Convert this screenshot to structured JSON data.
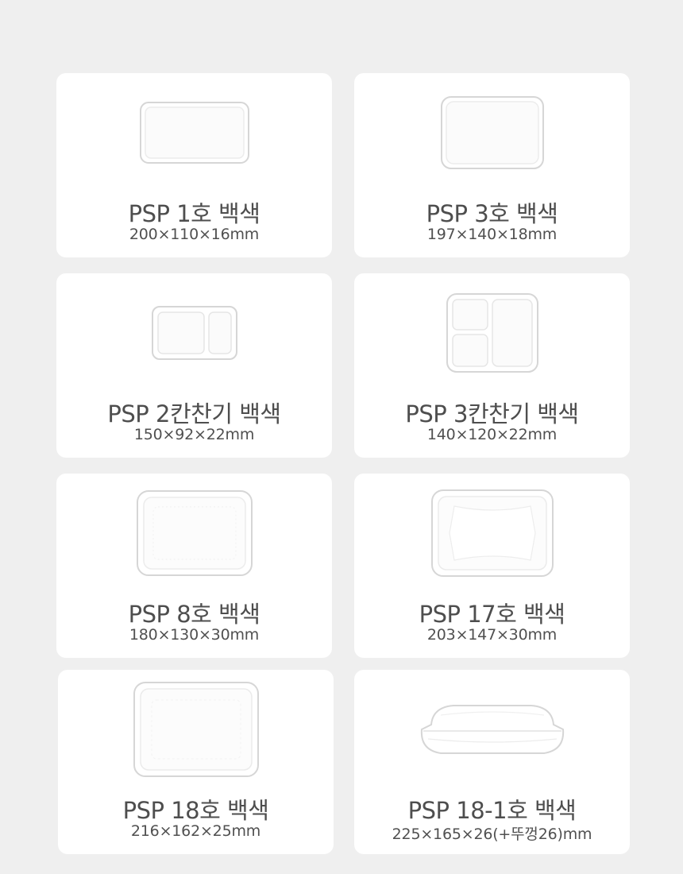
{
  "products": [
    {
      "name": "PSP 1호 백색",
      "size": "200×110×16mm",
      "icon": "single-tray-small"
    },
    {
      "name": "PSP 3호 백색",
      "size": "197×140×18mm",
      "icon": "single-tray-square"
    },
    {
      "name": "PSP 2칸찬기 백색",
      "size": "150×92×22mm",
      "icon": "two-compartment-tray"
    },
    {
      "name": "PSP 3칸찬기 백색",
      "size": "140×120×22mm",
      "icon": "three-compartment-tray"
    },
    {
      "name": "PSP 8호 백색",
      "size": "180×130×30mm",
      "icon": "deep-tray"
    },
    {
      "name": "PSP 17호 백색",
      "size": "203×147×30mm",
      "icon": "meat-tray-ribbed"
    },
    {
      "name": "PSP 18호 백색",
      "size": "216×162×25mm",
      "icon": "large-tray-ribbed"
    },
    {
      "name": "PSP 18-1호 백색",
      "size": "225×165×26(+뚜껑26)mm",
      "icon": "lidded-container"
    }
  ],
  "colors": {
    "background": "#efefef",
    "card": "#ffffff",
    "text": "#4e4e4e",
    "tray_outline": "#d9d9d9"
  }
}
